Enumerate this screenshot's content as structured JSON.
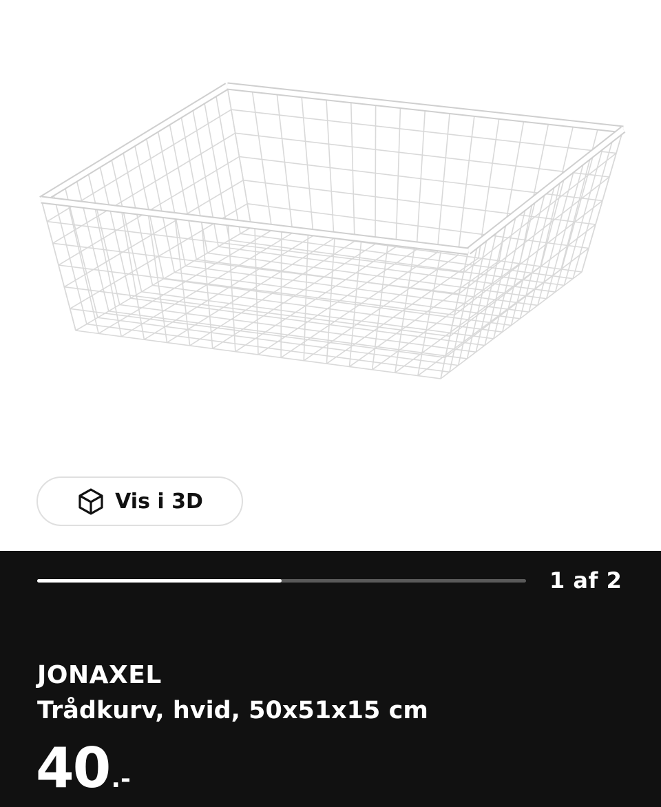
{
  "viewer": {
    "view_3d_label": "Vis i 3D",
    "view_3d_icon": "cube-icon",
    "pager_text": "1 af 2",
    "progress_fraction": 0.5
  },
  "product": {
    "name": "JONAXEL",
    "description": "Trådkurv, hvid, 50x51x15 cm",
    "price_integer": "40",
    "price_suffix": ".-"
  }
}
